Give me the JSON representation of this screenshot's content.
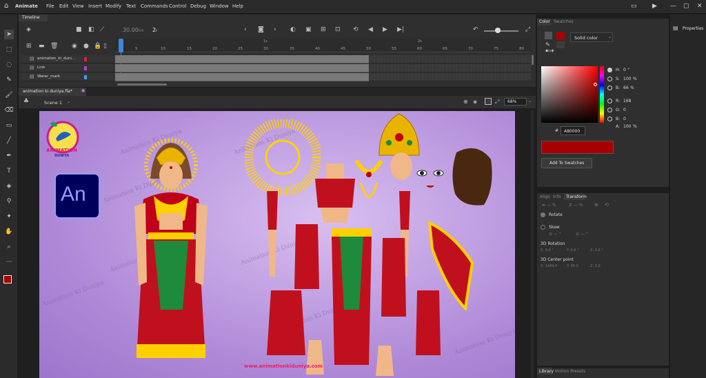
{
  "app": {
    "name": "Animate",
    "menu": [
      "File",
      "Edit",
      "View",
      "Insert",
      "Modify",
      "Text",
      "Commands",
      "Control",
      "Debug",
      "Window",
      "Help"
    ]
  },
  "timeline": {
    "tab_label": "Timeline",
    "fps": "30.00",
    "fps_unit": "FPS",
    "current_frame": "2",
    "frame_suffix": "F",
    "ruler": [
      "1s",
      "2s"
    ],
    "ruler_numbers": [
      "5",
      "10",
      "15",
      "20",
      "25",
      "30",
      "35",
      "40",
      "45",
      "50",
      "55",
      "60",
      "65",
      "70",
      "75",
      "80"
    ],
    "layers": [
      {
        "name": "animation_ki_duni...",
        "color": "#e0202a"
      },
      {
        "name": "Link",
        "color": "#c03ad0"
      },
      {
        "name": "Water_mark",
        "color": "#3aa0f0"
      }
    ]
  },
  "document": {
    "tab_label": "animation ki duniya.fla*",
    "scene_label": "Scene 1",
    "zoom": "68%"
  },
  "stage": {
    "background": "#b08ad8",
    "watermark_text": "Animation Ki Duniya",
    "logo_text_main": "ANIMATION",
    "logo_text_sub": "DUNIYA",
    "an_badge": "An",
    "website": "www.animationkiduniya.com"
  },
  "color_panel": {
    "tab_color": "Color",
    "tab_swatches": "Swatches",
    "fill_type": "Solid color",
    "h_label": "H:",
    "h_value": "0",
    "h_unit": "°",
    "s_label": "S:",
    "s_value": "100",
    "s_unit": "%",
    "b_label": "B:",
    "b_value": "66",
    "b_unit": "%",
    "r_label": "R:",
    "r_value": "168",
    "g_label": "G:",
    "g_value": "0",
    "bb_label": "B:",
    "bb_value": "0",
    "a_label": "A:",
    "a_value": "100",
    "a_unit": "%",
    "hex_prefix": "#",
    "hex_value": "A80000",
    "color": "#a80000",
    "add_to_swatches": "Add To Swatches"
  },
  "transform_panel": {
    "tabs": [
      "Align",
      "Info",
      "Transform"
    ],
    "rotate_label": "Rotate",
    "skew_label": "Skew",
    "rotation_3d_label": "3D Rotation",
    "rot_x": "X: 0.0 °",
    "rot_y": "Y: 0.0 °",
    "rot_z": "Z: 0.0 °",
    "center_label": "3D Center point",
    "center_x": "X: 1449.0",
    "center_y": "Y: 95.0",
    "center_z": "Z: 0.0"
  },
  "library_panel": {
    "tabs": [
      "Library",
      "Motion Presets"
    ]
  },
  "properties_panel": {
    "label": "Properties"
  }
}
